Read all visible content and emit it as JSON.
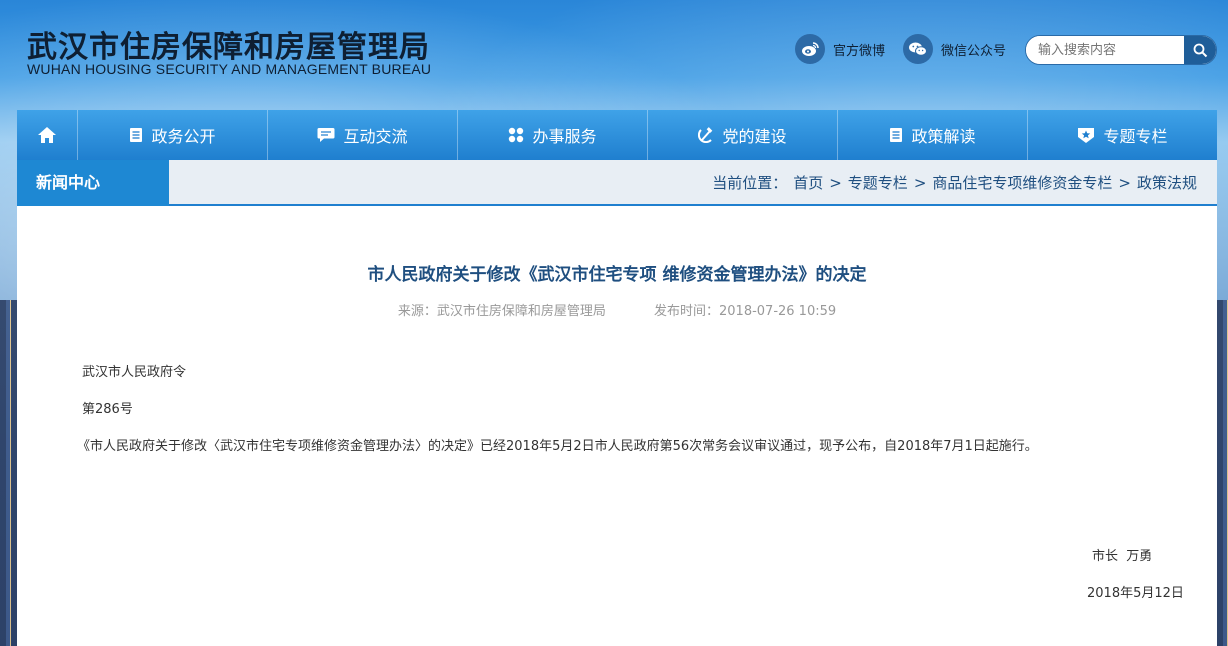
{
  "header": {
    "title": "武汉市住房保障和房屋管理局",
    "subtitle": "WUHAN HOUSING SECURITY AND MANAGEMENT BUREAU",
    "weibo_label": "官方微博",
    "wechat_label": "微信公众号",
    "search_placeholder": "输入搜索内容"
  },
  "nav": {
    "items": [
      {
        "label": "政务公开",
        "icon": "document-icon"
      },
      {
        "label": "互动交流",
        "icon": "chat-bubble-icon"
      },
      {
        "label": "办事服务",
        "icon": "grid-icon"
      },
      {
        "label": "党的建设",
        "icon": "party-emblem-icon"
      },
      {
        "label": "政策解读",
        "icon": "document-icon"
      },
      {
        "label": "专题专栏",
        "icon": "star-badge-icon"
      }
    ]
  },
  "section": {
    "tab_label": "新闻中心"
  },
  "breadcrumb": {
    "prefix": "当前位置：",
    "items": [
      "首页",
      "专题专栏",
      "商品住宅专项维修资金专栏",
      "政策法规"
    ],
    "separator": ">"
  },
  "article": {
    "title": "市人民政府关于修改《武汉市住宅专项 维修资金管理办法》的决定",
    "source": "来源：武汉市住房保障和房屋管理局",
    "published": "发布时间：2018-07-26 10:59",
    "paragraphs": [
      "武汉市人民政府令",
      "第286号",
      "《市人民政府关于修改〈武汉市住宅专项维修资金管理办法〉的决定》已经2018年5月2日市人民政府第56次常务会议审议通过，现予公布，自2018年7月1日起施行。"
    ],
    "signature": "市长  万勇",
    "date": "2018年5月12日"
  },
  "colors": {
    "nav_blue": "#1f7fcf",
    "tab_blue": "#1e88d3",
    "title_blue": "#1f4f80"
  }
}
